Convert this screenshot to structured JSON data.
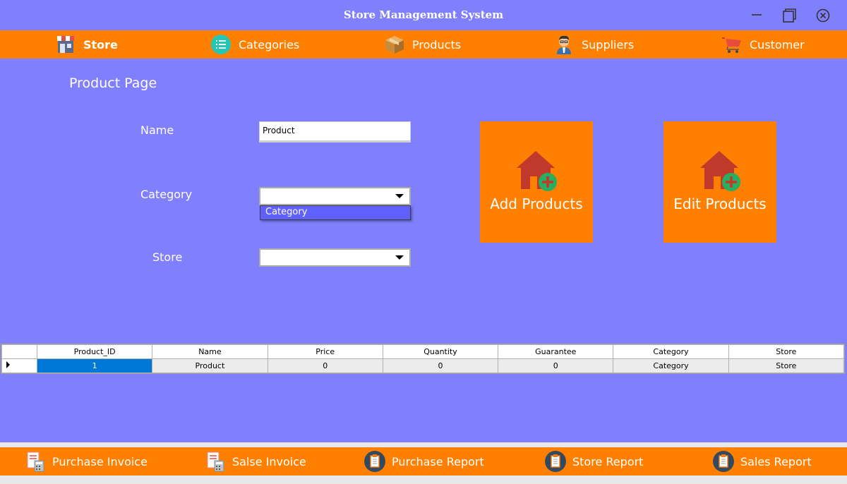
{
  "window": {
    "title": "Store Management System"
  },
  "top_nav": {
    "store": "Store",
    "categories": "Categories",
    "products": "Products",
    "suppliers": "Suppliers",
    "customer": "Customer"
  },
  "page": {
    "title": "Product Page"
  },
  "form": {
    "name_label": "Name",
    "name_value": "Product",
    "category_label": "Category",
    "category_value": "",
    "category_dropdown_option": "Category",
    "store_label": "Store",
    "store_value": ""
  },
  "actions": {
    "add_label": "Add Products",
    "edit_label": "Edit Products"
  },
  "grid": {
    "columns": [
      "Product_ID",
      "Name",
      "Price",
      "Quantity",
      "Guarantee",
      "Category",
      "Store"
    ],
    "rows": [
      [
        "1",
        "Product",
        "0",
        "0",
        "0",
        "Category",
        "Store"
      ]
    ]
  },
  "bottom_nav": {
    "purchase_invoice": "Purchase Invoice",
    "sales_invoice": "Salse Invoice",
    "purchase_report": "Purchase Report",
    "store_report": "Store Report",
    "sales_report": "Sales Report"
  },
  "colors": {
    "background": "#8080ff",
    "accent": "#ff8000",
    "selection": "#0078d7",
    "dropdown_highlight": "#6060ff"
  }
}
